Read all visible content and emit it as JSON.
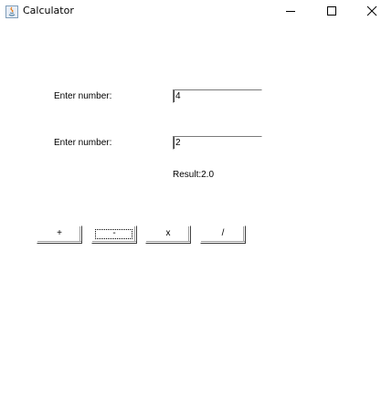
{
  "window": {
    "title": "Calculator",
    "icon": "java-app-icon",
    "controls": [
      "minimize-icon",
      "maximize-icon",
      "close-icon"
    ]
  },
  "form": {
    "label_first": "Enter number:",
    "value_first": "4",
    "label_second": "Enter number:",
    "value_second": "2",
    "result": "Result:2.0"
  },
  "operations": {
    "plus": "+",
    "minus": "-",
    "multiply": "x",
    "divide": "/"
  }
}
